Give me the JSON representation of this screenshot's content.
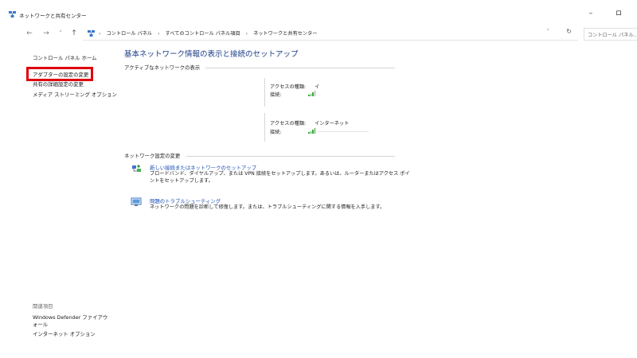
{
  "window": {
    "title": "ネットワークと共有センター",
    "minimize_glyph": "–",
    "restore_glyph": "ロ"
  },
  "nav": {
    "back_glyph": "←",
    "forward_glyph": "→",
    "recent_glyph": "˅",
    "up_glyph": "↑",
    "breadcrumbs": [
      "コントロール パネル",
      "すべてのコントロール パネル項目",
      "ネットワークと共有センター"
    ],
    "separator": "›",
    "dropdown_glyph": "˅",
    "refresh_glyph": "↻",
    "search_placeholder": "コントロール パネル..."
  },
  "sidebar": {
    "home": "コントロール パネル ホーム",
    "links": [
      "アダプターの設定の変更",
      "共有の詳細設定の変更",
      "メディア ストリーミング オプション"
    ],
    "related_header": "関連項目",
    "related_links": [
      "Windows Defender ファイアウォール",
      "インターネット オプション"
    ]
  },
  "main": {
    "heading": "基本ネットワーク情報の表示と接続のセットアップ",
    "active_networks_title": "アクティブなネットワークの表示",
    "networks": [
      {
        "access_label": "アクセスの種類:",
        "access_value": "イ",
        "connection_label": "接続:"
      },
      {
        "access_label": "アクセスの種類:",
        "access_value": "インターネット",
        "connection_label": "接続:"
      }
    ],
    "settings_title": "ネットワーク設定の変更",
    "tasks": [
      {
        "link": "新しい接続またはネットワークのセットアップ",
        "desc": "ブロードバンド、ダイヤルアップ、または VPN 接続をセットアップします。あるいは、ルーターまたはアクセス ポイントをセットアップします。"
      },
      {
        "link": "問題のトラブルシューティング",
        "desc": "ネットワークの問題を診断して修復します。または、トラブルシューティングに関する情報を入手します。"
      }
    ]
  },
  "colors": {
    "heading": "#1b3c87",
    "link": "#1b4fb3",
    "highlight": "#e0000e",
    "signal": "#2fa32f"
  }
}
